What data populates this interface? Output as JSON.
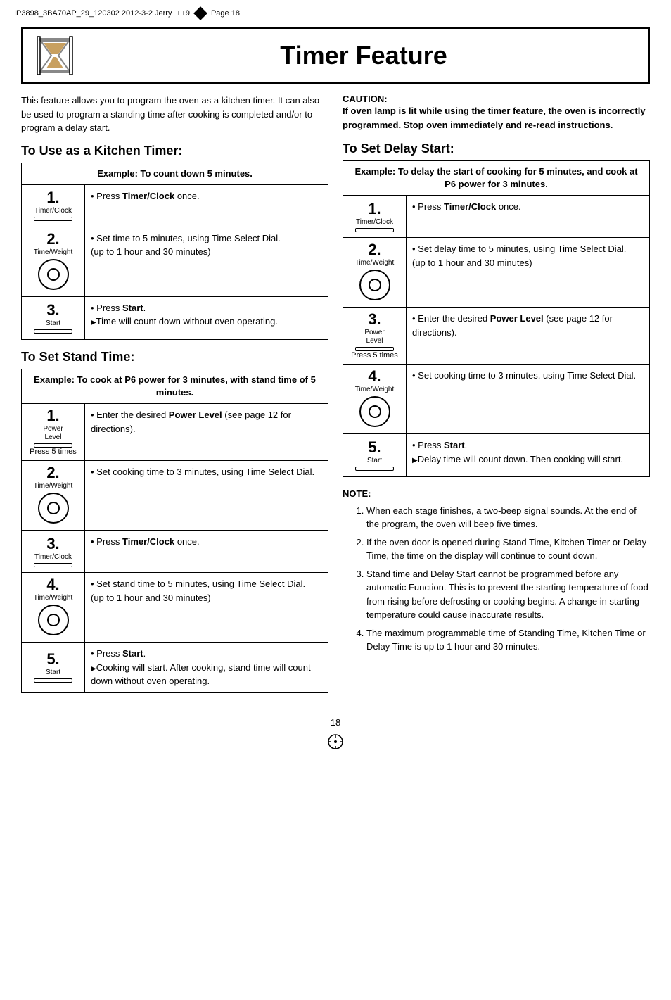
{
  "doc_header": {
    "text": "IP3898_3BA70AP_29_120302  2012-3-2  Jerry  □□ 9",
    "page_ref": "Page 18"
  },
  "title": "Timer Feature",
  "intro": "This feature allows you to program the oven as a kitchen timer. It can also be used to program a standing time after cooking is completed and/or to program a delay start.",
  "caution": {
    "title": "CAUTION:",
    "text": "If oven lamp is lit while using the timer feature, the oven is incorrectly programmed. Stop oven immediately and re-read instructions."
  },
  "kitchen_timer": {
    "section_title": "To Use  as a Kitchen Timer:",
    "example_header": "Example: To count down 5 minutes.",
    "steps": [
      {
        "num": "1.",
        "label": "Timer/Clock",
        "type": "button",
        "instruction": "• Press Timer/Clock once."
      },
      {
        "num": "2.",
        "label": "Time/Weight",
        "type": "dial",
        "instruction": "• Set time to 5 minutes, using Time Select Dial.\n(up to 1 hour and 30 minutes)"
      },
      {
        "num": "3.",
        "label": "Start",
        "type": "button",
        "instruction": "• Press Start.\n▶Time will count down without oven operating."
      }
    ]
  },
  "stand_time": {
    "section_title": "To Set Stand Time:",
    "example_header": "Example: To cook at P6 power for 3 minutes, with stand time of 5 minutes.",
    "steps": [
      {
        "num": "1.",
        "label": "Power\nLevel",
        "sublabel": "Press 5 times",
        "type": "button",
        "instruction": "• Enter the desired Power Level (see page 12 for directions)."
      },
      {
        "num": "2.",
        "label": "Time/Weight",
        "type": "dial",
        "instruction": "• Set cooking time to 3 minutes, using Time Select Dial."
      },
      {
        "num": "3.",
        "label": "Timer/Clock",
        "type": "button",
        "instruction": "• Press Timer/Clock once."
      },
      {
        "num": "4.",
        "label": "Time/Weight",
        "type": "dial",
        "instruction": "• Set stand time to 5 minutes, using Time Select Dial.\n(up to 1 hour and 30 minutes)"
      },
      {
        "num": "5.",
        "label": "Start",
        "type": "button",
        "instruction": "• Press Start.\n▶Cooking will start. After cooking, stand time will count down without oven operating."
      }
    ]
  },
  "delay_start": {
    "section_title": "To Set Delay Start:",
    "example_header": "Example: To delay the start of cooking for 5 minutes, and cook at P6 power for 3 minutes.",
    "steps": [
      {
        "num": "1.",
        "label": "Timer/Clock",
        "type": "button",
        "instruction": "• Press Timer/Clock once."
      },
      {
        "num": "2.",
        "label": "Time/Weight",
        "type": "dial",
        "instruction": "• Set delay time to 5 minutes, using Time Select Dial.\n(up to 1 hour and 30 minutes)"
      },
      {
        "num": "3.",
        "label": "Power\nLevel",
        "sublabel": "Press 5 times",
        "type": "button",
        "instruction": "• Enter the desired Power Level (see page 12 for directions)."
      },
      {
        "num": "4.",
        "label": "Time/Weight",
        "type": "dial",
        "instruction": "• Set cooking time to 3 minutes, using Time Select Dial."
      },
      {
        "num": "5.",
        "label": "Start",
        "type": "button",
        "instruction": "• Press Start.\n▶Delay time will count down. Then cooking will start."
      }
    ]
  },
  "notes": {
    "title": "NOTE:",
    "items": [
      "When each stage finishes, a two-beep signal sounds. At the end of the program, the oven will beep five times.",
      "If the oven door is opened during Stand Time, Kitchen Timer or Delay Time, the time on the display will continue to count down.",
      "Stand time and Delay Start cannot be programmed before any automatic Function. This is to prevent the starting temperature of food from rising before defrosting or cooking begins. A change in starting temperature could cause inaccurate results.",
      "The maximum programmable time of Standing Time, Kitchen Time or Delay Time is up to 1 hour and 30 minutes."
    ]
  },
  "page_number": "18"
}
